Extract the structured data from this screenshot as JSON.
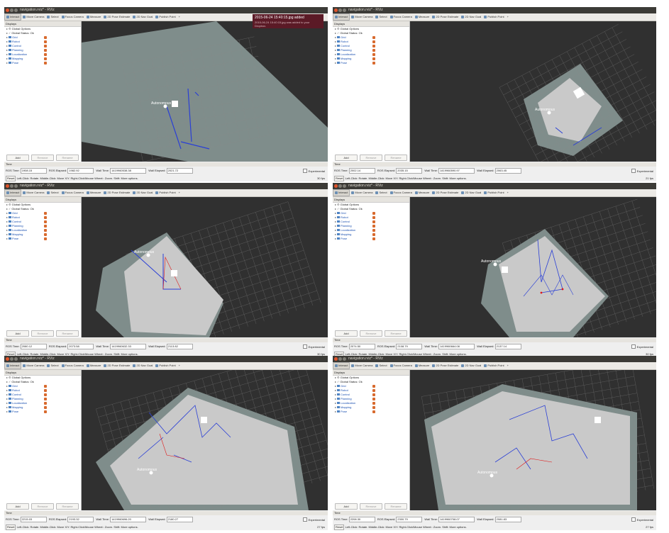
{
  "windows": [
    {
      "title": "navigation.rviz* - RViz",
      "tools": [
        "Interact",
        "Move Camera",
        "Select",
        "Focus Camera",
        "Measure",
        "2D Pose Estimate",
        "2D Nav Goal",
        "Publish Point"
      ],
      "displays_header": "Displays",
      "displays": [
        {
          "label": "Global Options",
          "type": "global"
        },
        {
          "label": "Global Status: Ok",
          "type": "status"
        },
        {
          "label": "Grid",
          "type": "item"
        },
        {
          "label": "Robot",
          "type": "folder"
        },
        {
          "label": "Control",
          "type": "folder"
        },
        {
          "label": "Planning",
          "type": "folder"
        },
        {
          "label": "Localization",
          "type": "folder"
        },
        {
          "label": "Mapping",
          "type": "folder"
        },
        {
          "label": "Pose",
          "type": "item"
        }
      ],
      "buttons": [
        "Add",
        "Remove",
        "Rename"
      ],
      "time_header": "Time",
      "ros_time_label": "ROS Time:",
      "ros_time": "1908.15",
      "ros_elapsed_label": "ROS Elapsed:",
      "ros_elapsed": "1982.92",
      "wall_time_label": "Wall Time:",
      "wall_time": "1419960538.38",
      "wall_elapsed_label": "Wall Elapsed:",
      "wall_elapsed": "2021.72",
      "experimental_label": "Experimental",
      "reset_label": "Reset",
      "status_text": "Left-Click: Rotate. Middle-Click: Move X/Y. Right-Click/Mouse Wheel:: Zoom. Shift: More options.",
      "fps": "30 fps",
      "robot_label": "Autonomous",
      "notification": {
        "title": "2015-06-24 15:40:15.jpg added",
        "subtitle": "2015-06-24 15:40:15.jpg was added to your Dropbox."
      }
    },
    {
      "title": "navigation.rviz* - RViz",
      "tools": [
        "Interact",
        "Move Camera",
        "Select",
        "Focus Camera",
        "Measure",
        "2D Pose Estimate",
        "2D Nav Goal",
        "Publish Point"
      ],
      "displays_header": "Displays",
      "displays": [
        {
          "label": "Global Options",
          "type": "global"
        },
        {
          "label": "Global Status: Ok",
          "type": "status"
        },
        {
          "label": "Grid",
          "type": "item"
        },
        {
          "label": "Robot",
          "type": "folder"
        },
        {
          "label": "Control",
          "type": "folder"
        },
        {
          "label": "Planning",
          "type": "folder"
        },
        {
          "label": "Localization",
          "type": "folder"
        },
        {
          "label": "Mapping",
          "type": "folder"
        },
        {
          "label": "Pose",
          "type": "item"
        }
      ],
      "buttons": [
        "Add",
        "Remove",
        "Rename"
      ],
      "time_header": "Time",
      "ros_time_label": "ROS Time:",
      "ros_time": "2002.14",
      "ros_elapsed_label": "ROS Elapsed:",
      "ros_elapsed": "2035.15",
      "wall_time_label": "Wall Time:",
      "wall_time": "1419960590.97",
      "wall_elapsed_label": "Wall Elapsed:",
      "wall_elapsed": "2063.45",
      "experimental_label": "Experimental",
      "reset_label": "Reset",
      "status_text": "Left-Click: Rotate. Middle-Click: Move X/Y. Right-Click/Mouse Wheel:: Zoom. Shift: More options.",
      "fps": "21 fps",
      "robot_label": "Autonomous"
    },
    {
      "title": "navigation.rviz* - RViz",
      "tools": [
        "Interact",
        "Move Camera",
        "Select",
        "Focus Camera",
        "Measure",
        "2D Pose Estimate",
        "2D Nav Goal",
        "Publish Point"
      ],
      "displays_header": "Displays",
      "displays": [
        {
          "label": "Global Options",
          "type": "global"
        },
        {
          "label": "Global Status: Ok",
          "type": "status"
        },
        {
          "label": "Grid",
          "type": "item"
        },
        {
          "label": "Robot",
          "type": "folder"
        },
        {
          "label": "Control",
          "type": "folder"
        },
        {
          "label": "Planning",
          "type": "folder"
        },
        {
          "label": "Localization",
          "type": "folder"
        },
        {
          "label": "Mapping",
          "type": "folder"
        },
        {
          "label": "Pose",
          "type": "item"
        }
      ],
      "buttons": [
        "Add",
        "Remove",
        "Rename"
      ],
      "time_header": "Time",
      "ros_time_label": "ROS Time:",
      "ros_time": "2080.12",
      "ros_elapsed_label": "ROS Elapsed:",
      "ros_elapsed": "2073.58",
      "wall_time_label": "Wall Time:",
      "wall_time": "1419960632.33",
      "wall_elapsed_label": "Wall Elapsed:",
      "wall_elapsed": "2113.82",
      "experimental_label": "Experimental",
      "reset_label": "Reset",
      "status_text": "Left-Click: Rotate. Middle-Click: Move X/Y. Right-Click/Mouse Wheel:: Zoom. Shift: More options.",
      "fps": "30 fps",
      "robot_label": "Autonomous"
    },
    {
      "title": "navigation.rviz* - RViz",
      "tools": [
        "Interact",
        "Move Camera",
        "Select",
        "Focus Camera",
        "Measure",
        "2D Pose Estimate",
        "2D Nav Goal",
        "Publish Point"
      ],
      "displays_header": "Displays",
      "displays": [
        {
          "label": "Global Options",
          "type": "global"
        },
        {
          "label": "Global Status: Ok",
          "type": "status"
        },
        {
          "label": "Grid",
          "type": "item"
        },
        {
          "label": "Robot",
          "type": "folder"
        },
        {
          "label": "Control",
          "type": "folder"
        },
        {
          "label": "Planning",
          "type": "folder"
        },
        {
          "label": "Localization",
          "type": "folder"
        },
        {
          "label": "Mapping",
          "type": "folder"
        },
        {
          "label": "Pose",
          "type": "item"
        }
      ],
      "buttons": [
        "Add",
        "Remove",
        "Rename"
      ],
      "time_header": "Time",
      "ros_time_label": "ROS Time:",
      "ros_time": "2074.50",
      "ros_elapsed_label": "ROS Elapsed:",
      "ros_elapsed": "2108.79",
      "wall_time_label": "Wall Time:",
      "wall_time": "1419960664.08",
      "wall_elapsed_label": "Wall Elapsed:",
      "wall_elapsed": "2137.14",
      "experimental_label": "Experimental",
      "reset_label": "Reset",
      "status_text": "Left-Click: Rotate. Middle-Click: Move X/Y. Right-Click/Mouse Wheel:: Zoom. Shift: More options.",
      "fps": "30 fps",
      "robot_label": "Autonomous"
    },
    {
      "title": "navigation.rviz* - RViz",
      "tools": [
        "Interact",
        "Move Camera",
        "Select",
        "Focus Camera",
        "Measure",
        "2D Pose Estimate",
        "2D Nav Goal",
        "Publish Point"
      ],
      "displays_header": "Displays",
      "displays": [
        {
          "label": "Global Options",
          "type": "global"
        },
        {
          "label": "Global Status: Ok",
          "type": "status"
        },
        {
          "label": "Grid",
          "type": "item"
        },
        {
          "label": "Robot",
          "type": "folder"
        },
        {
          "label": "Control",
          "type": "folder"
        },
        {
          "label": "Planning",
          "type": "folder"
        },
        {
          "label": "Localization",
          "type": "folder"
        },
        {
          "label": "Mapping",
          "type": "folder"
        },
        {
          "label": "Pose",
          "type": "item"
        }
      ],
      "buttons": [
        "Add",
        "Remove",
        "Rename"
      ],
      "time_header": "Time",
      "ros_time_label": "ROS Time:",
      "ros_time": "2215.03",
      "ros_elapsed_label": "ROS Elapsed:",
      "ros_elapsed": "2193.32",
      "wall_time_label": "Wall Time:",
      "wall_time": "1419960696.20",
      "wall_elapsed_label": "Wall Elapsed:",
      "wall_elapsed": "2180.27",
      "experimental_label": "Experimental",
      "reset_label": "Reset",
      "status_text": "Left-Click: Rotate. Middle-Click: Move X/Y. Right-Click/Mouse Wheel:: Zoom. Shift: More options.",
      "fps": "27 fps",
      "robot_label": "Autonomous"
    },
    {
      "title": "navigation.rviz* - RViz",
      "tools": [
        "Interact",
        "Move Camera",
        "Select",
        "Focus Camera",
        "Measure",
        "2D Pose Estimate",
        "2D Nav Goal",
        "Publish Point"
      ],
      "displays_header": "Displays",
      "displays": [
        {
          "label": "Global Options",
          "type": "global"
        },
        {
          "label": "Global Status: Ok",
          "type": "status"
        },
        {
          "label": "Grid",
          "type": "item"
        },
        {
          "label": "Robot",
          "type": "folder"
        },
        {
          "label": "Control",
          "type": "folder"
        },
        {
          "label": "Planning",
          "type": "folder"
        },
        {
          "label": "Localization",
          "type": "folder"
        },
        {
          "label": "Mapping",
          "type": "folder"
        },
        {
          "label": "Pose",
          "type": "item"
        }
      ],
      "buttons": [
        "Add",
        "Remove",
        "Rename"
      ],
      "time_header": "Time",
      "ros_time_label": "ROS Time:",
      "ros_time": "2208.30",
      "ros_elapsed_label": "ROS Elapsed:",
      "ros_elapsed": "2300.79",
      "wall_time_label": "Wall Time:",
      "wall_time": "1419960708.07",
      "wall_elapsed_label": "Wall Elapsed:",
      "wall_elapsed": "2081.83",
      "experimental_label": "Experimental",
      "reset_label": "Reset",
      "status_text": "Left-Click: Rotate. Middle-Click: Move X/Y. Right-Click/Mouse Wheel:: Zoom. Shift: More options.",
      "fps": "27 fps",
      "robot_label": "Autonomous"
    }
  ],
  "colors": {
    "map_gray": "#b4b4b4",
    "map_dark": "#7f8d8b",
    "wall_blue": "#2a3fd6",
    "path_red": "#e01818",
    "background": "#303030"
  }
}
